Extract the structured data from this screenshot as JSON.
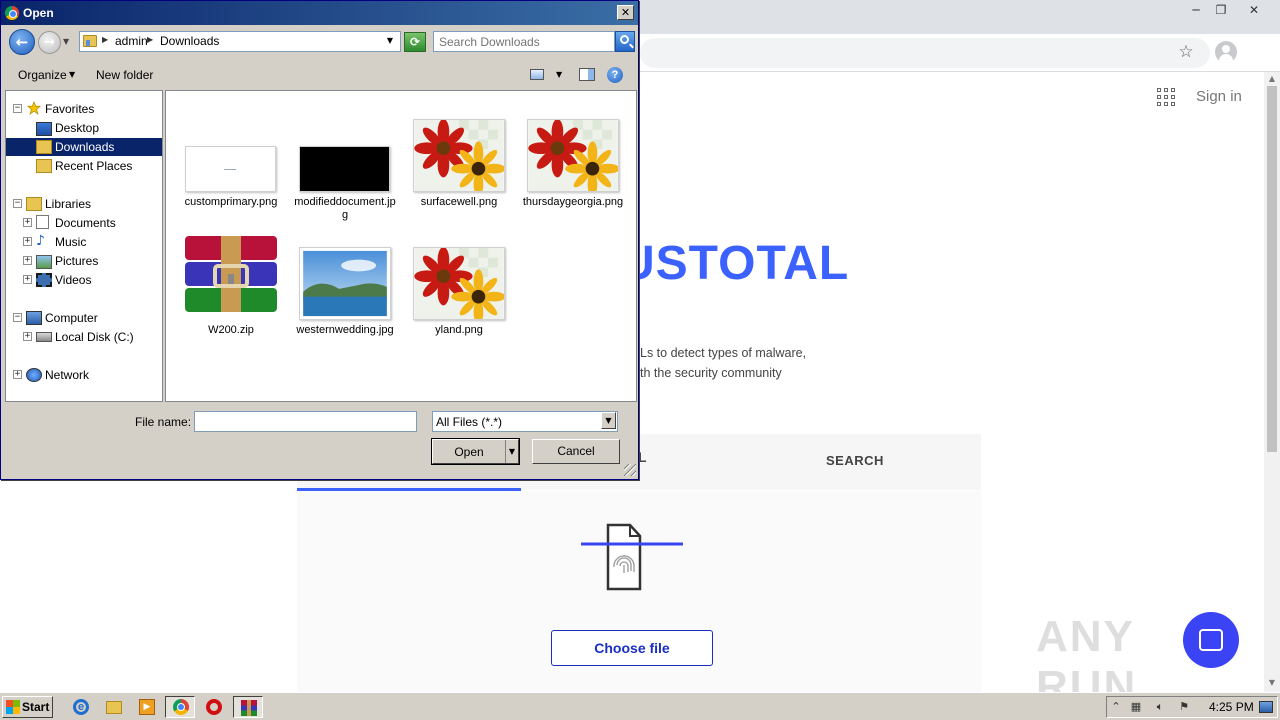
{
  "browser": {
    "sign_in": "Sign in",
    "logo_fragment": "USTOTAL",
    "desc_line1": "Ls to detect types of malware,",
    "desc_line2": "th the security community",
    "tab_fragment": "L",
    "tab_search": "SEARCH",
    "choose_file": "Choose file",
    "watermark": "ANY RUN",
    "accent_color": "#3b61ff"
  },
  "dialog": {
    "title": "Open",
    "close_glyph": "✕",
    "breadcrumb": [
      "admin",
      "Downloads"
    ],
    "search_placeholder": "Search Downloads",
    "organize": "Organize",
    "new_folder": "New folder",
    "help": "?",
    "nav_tree": {
      "favorites": "Favorites",
      "desktop": "Desktop",
      "downloads": "Downloads",
      "recent_places": "Recent Places",
      "libraries": "Libraries",
      "documents": "Documents",
      "music": "Music",
      "pictures": "Pictures",
      "videos": "Videos",
      "computer": "Computer",
      "local_disk": "Local Disk (C:)",
      "network": "Network"
    },
    "files": [
      {
        "name": "customprimary.png",
        "kind": "white-image"
      },
      {
        "name": "modifieddocument.jpg",
        "kind": "black-image"
      },
      {
        "name": "surfacewell.png",
        "kind": "flower-image"
      },
      {
        "name": "thursdaygeorgia.png",
        "kind": "flower-image"
      },
      {
        "name": "W200.zip",
        "kind": "winrar-archive"
      },
      {
        "name": "westernwedding.jpg",
        "kind": "landscape-image"
      },
      {
        "name": "yland.png",
        "kind": "flower-image"
      }
    ],
    "file_name_label": "File name:",
    "file_name_value": "",
    "file_type": "All Files (*.*)",
    "open_button": "Open",
    "cancel_button": "Cancel"
  },
  "taskbar": {
    "start": "Start",
    "clock": "4:25 PM"
  }
}
